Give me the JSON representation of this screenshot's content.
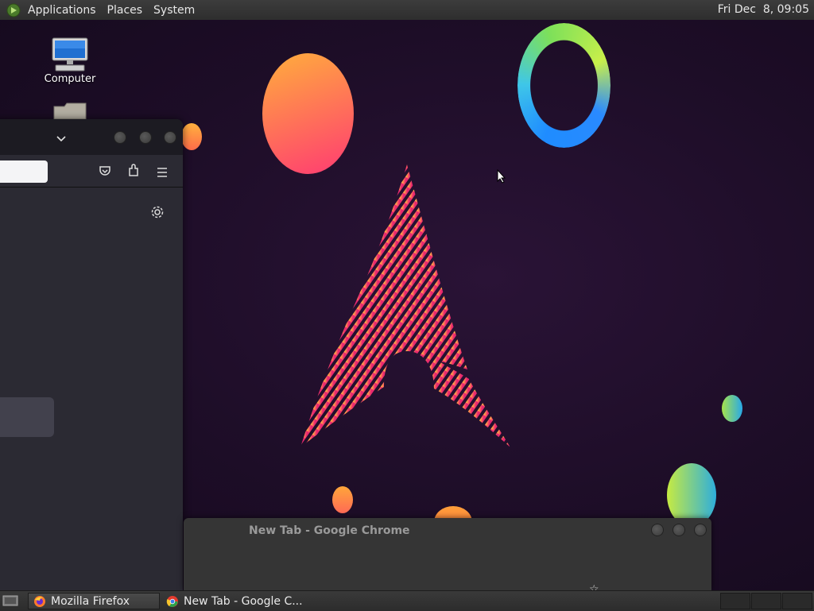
{
  "top_panel": {
    "menus": [
      "Applications",
      "Places",
      "System"
    ],
    "clock": "Fri Dec  8, 09:05"
  },
  "desktop": {
    "icons": [
      {
        "label": "Computer",
        "icon": "computer-icon"
      },
      {
        "label": "",
        "icon": "folder-icon"
      }
    ]
  },
  "firefox_window": {
    "toolbar_icons": [
      "pocket-icon",
      "extensions-icon",
      "hamburger-menu-icon"
    ],
    "settings_icon": "gear-icon"
  },
  "chrome_window": {
    "title": "New Tab - Google Chrome"
  },
  "taskbar": {
    "tasks": [
      {
        "label": "Mozilla Firefox",
        "icon": "firefox-icon",
        "active": true
      },
      {
        "label": "New Tab - Google C...",
        "icon": "chrome-icon",
        "active": false
      }
    ]
  },
  "colors": {
    "panel": "#333333",
    "desktop_bg": "#1d0d27",
    "firefox_bg": "#2b2a33",
    "arch_pink": "#e8286f"
  }
}
